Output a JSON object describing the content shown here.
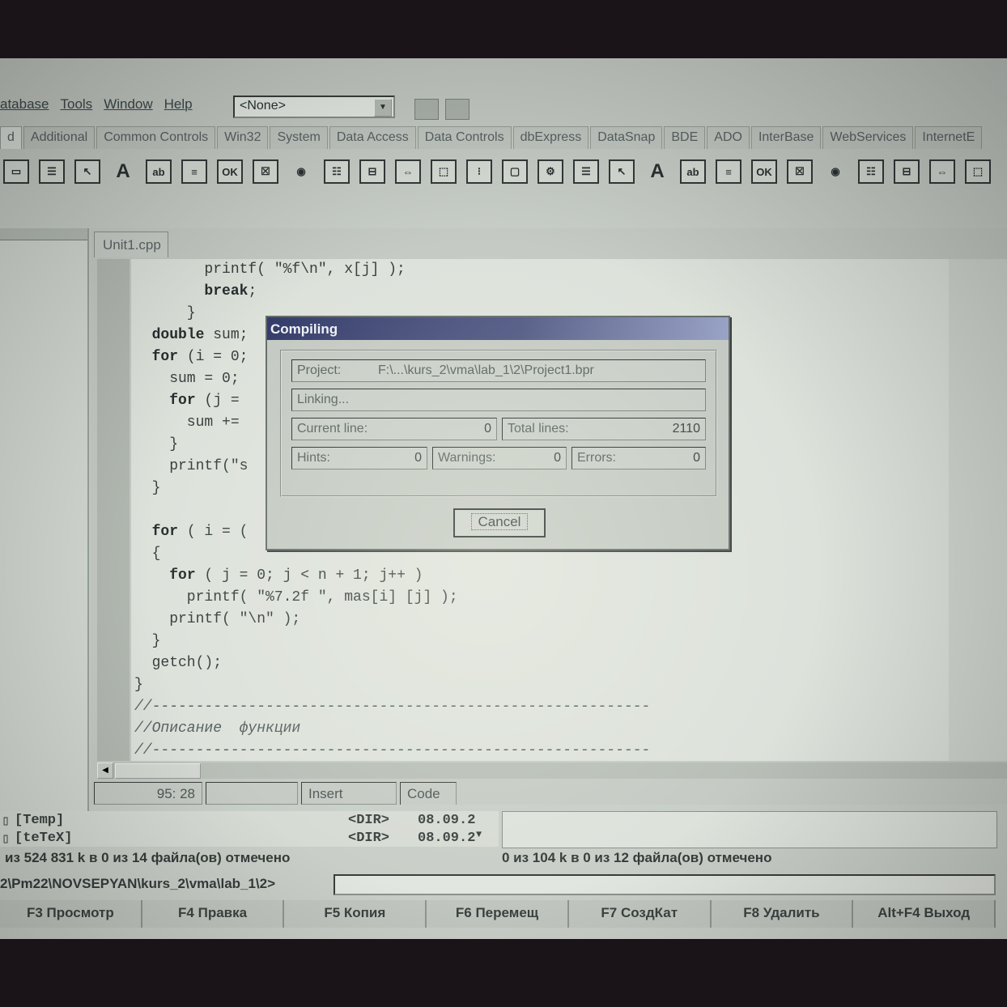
{
  "menu": {
    "items": [
      "atabase",
      "Tools",
      "Window",
      "Help"
    ]
  },
  "toolbar": {
    "combo_value": "<None>"
  },
  "palette": {
    "tabs": [
      "d",
      "Additional",
      "Common Controls",
      "Win32",
      "System",
      "Data Access",
      "Data Controls",
      "dbExpress",
      "DataSnap",
      "BDE",
      "ADO",
      "InterBase",
      "WebServices",
      "InternetE"
    ],
    "icons": [
      "frame-icon",
      "mainmenu-icon",
      "popupmenu-icon",
      "label-icon",
      "edit-icon",
      "memo-icon",
      "button-icon",
      "checkbox-icon",
      "radiobutton-icon",
      "listbox-icon",
      "combobox-icon",
      "scrollbar-icon",
      "groupbox-icon",
      "radiogroup-icon",
      "panel-icon",
      "actionlist-icon",
      "mainmenu-icon",
      "popupmenu-icon",
      "label-icon",
      "edit-icon",
      "memo-icon",
      "button-icon",
      "checkbox-icon",
      "radiobutton-icon",
      "listbox-icon",
      "combobox-icon",
      "scrollbar-icon",
      "groupbox-icon"
    ]
  },
  "editor": {
    "tab_label": "Unit1.cpp",
    "code_lines": [
      "        printf( \"%f\\n\", x[j] );",
      "        break;",
      "      }",
      "  double sum;",
      "  for (i = 0;",
      "    sum = 0;",
      "    for (j =",
      "      sum +=",
      "    }",
      "    printf(\"s",
      "  }",
      "",
      "  for ( i = (",
      "  {",
      "    for ( j = 0; j < n + 1; j++ )",
      "      printf( \"%7.2f \", mas[i] [j] );",
      "    printf( \"\\n\" );",
      "  }",
      "  getch();",
      "}",
      "//---------------------------------------------------------",
      "//Описание  функции",
      "//---------------------------------------------------------"
    ],
    "status_position": "95: 28",
    "status_mode": "Insert",
    "status_view_tab": "Code"
  },
  "dialog": {
    "title": "Compiling",
    "project_label": "Project:",
    "project_value": "F:\\...\\kurs_2\\vma\\lab_1\\2\\Project1.bpr",
    "status": "Linking...",
    "current_line_label": "Current line:",
    "current_line_value": "0",
    "total_lines_label": "Total lines:",
    "total_lines_value": "2110",
    "hints_label": "Hints:",
    "hints_value": "0",
    "warnings_label": "Warnings:",
    "warnings_value": "0",
    "errors_label": "Errors:",
    "errors_value": "0",
    "cancel_label": "Cancel"
  },
  "file_manager": {
    "rows": [
      {
        "name": "[Temp]",
        "type": "<DIR>",
        "date": "08.09.2"
      },
      {
        "name": "[teTeX]",
        "type": "<DIR>",
        "date": "08.09.2"
      }
    ],
    "left_info": "из 524 831 k в 0 из 14 файла(ов) отмечено",
    "right_info": "0 из 104 k в 0 из 12 файла(ов) отмечено",
    "path": "2\\Pm22\\NOVSEPYAN\\kurs_2\\vma\\lab_1\\2>",
    "fkeys": [
      "F3 Просмотр",
      "F4 Правка",
      "F5 Копия",
      "F6 Перемещ",
      "F7 СоздКат",
      "F8 Удалить",
      "Alt+F4 Выход"
    ]
  }
}
